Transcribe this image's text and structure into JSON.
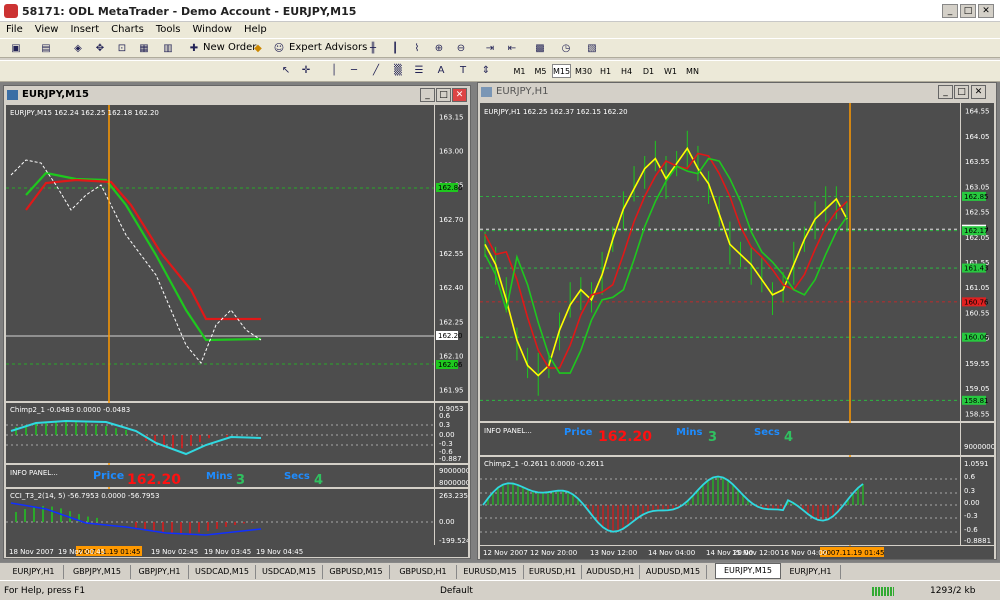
{
  "window": {
    "title": "58171: ODL MetaTrader - Demo Account - EURJPY,M15"
  },
  "menu": [
    "File",
    "View",
    "Insert",
    "Charts",
    "Tools",
    "Window",
    "Help"
  ],
  "toolbar": {
    "new_order": "New Order",
    "expert_advisors": "Expert Advisors"
  },
  "timeframes": [
    "M1",
    "M5",
    "M15",
    "M30",
    "H1",
    "H4",
    "D1",
    "W1",
    "MN"
  ],
  "timeframe_selected": "M15",
  "left_chart": {
    "title": "EURJPY,M15",
    "ohlc": "EURJPY,M15  162.24 162.25 162.18 162.20",
    "price_ticks": [
      "163.15",
      "163.00",
      "162.85",
      "162.70",
      "162.55",
      "162.40",
      "162.25",
      "162.10",
      "161.95"
    ],
    "price_ylim": [
      161.9,
      163.2
    ],
    "current_price": "162.20",
    "green_level": "162.86",
    "green_level2": "162.06",
    "chimp": {
      "label": "Chimp2_1 -0.0483 0.0000 -0.0483",
      "ticks": [
        "0.9053",
        "0.6",
        "0.3",
        "0.00",
        "-0.3",
        "-0.6",
        "-0.887"
      ]
    },
    "info": {
      "label": "INFO PANEL...",
      "price_label": "Price",
      "price_value": "162.20",
      "mins_label": "Mins",
      "mins_value": "3",
      "secs_label": "Secs",
      "secs_value": "4",
      "axis": [
        "9000000",
        "8000000"
      ]
    },
    "cci": {
      "label": "CCI_T3_2(14, 5) -56.7953 0.0000 -56.7953",
      "ticks": [
        "263.2353",
        "0.00",
        "-199.524"
      ]
    },
    "time_labels": [
      "18 Nov 2007",
      "19 Nov 00:45",
      "19 Nov 01:45",
      "19 Nov 02:45",
      "19 Nov 03:45",
      "19 Nov 04:45"
    ],
    "cursor_time": "2007.11.19 01:45"
  },
  "right_chart": {
    "title": "EURJPY,H1",
    "ohlc": "EURJPY,H1  162.25 162.37 162.15 162.20",
    "price_ticks": [
      "164.55",
      "164.05",
      "163.55",
      "163.05",
      "162.55",
      "162.05",
      "161.55",
      "161.05",
      "160.55",
      "160.05",
      "159.55",
      "159.05",
      "158.55"
    ],
    "price_ylim": [
      158.4,
      164.7
    ],
    "tags": [
      {
        "text": "162.85",
        "price": 162.85,
        "color": "#27c93f"
      },
      {
        "text": "162.20",
        "price": 162.2,
        "color": "#ffffff"
      },
      {
        "text": "162.17",
        "price": 162.17,
        "color": "#27c93f"
      },
      {
        "text": "161.43",
        "price": 161.43,
        "color": "#27c93f"
      },
      {
        "text": "160.76",
        "price": 160.76,
        "color": "#e02020"
      },
      {
        "text": "160.06",
        "price": 160.06,
        "color": "#27c93f"
      },
      {
        "text": "158.81",
        "price": 158.81,
        "color": "#27c93f"
      }
    ],
    "info": {
      "label": "INFO PANEL...",
      "price_label": "Price",
      "price_value": "162.20",
      "mins_label": "Mins",
      "mins_value": "3",
      "secs_label": "Secs",
      "secs_value": "4",
      "axis": [
        "9000000"
      ]
    },
    "chimp": {
      "label": "Chimp2_1 -0.2611 0.0000 -0.2611",
      "ticks": [
        "1.0591",
        "0.6",
        "0.3",
        "0.00",
        "-0.3",
        "-0.6",
        "-0.8881"
      ]
    },
    "time_labels": [
      "12 Nov 2007",
      "12 Nov 20:00",
      "13 Nov 12:00",
      "14 Nov 04:00",
      "14 Nov 20:00",
      "15 Nov 12:00",
      "16 Nov 04:00",
      "16 Nov 20:00"
    ],
    "cursor_time": "2007.11.19 01:45"
  },
  "tabs": [
    "EURJPY,H1",
    "GBPJPY,M15",
    "GBPJPY,H1",
    "USDCAD,M15",
    "USDCAD,M15",
    "GBPUSD,M15",
    "GBPUSD,H1",
    "EURUSD,M15",
    "EURUSD,H1",
    "AUDUSD,H1",
    "AUDUSD,M15",
    "EURJPY,M15",
    "EURJPY,H1"
  ],
  "active_tab": 11,
  "status": {
    "help": "For Help, press F1",
    "profile": "Default",
    "traffic": "1293/2 kb"
  },
  "colors": {
    "bg": "#4d4d4d",
    "green": "#1ec81e",
    "red": "#e01818",
    "yellow": "#ffff00",
    "cyan": "#30d8e0",
    "orange": "#ff9900",
    "blue": "#1060ff",
    "grid": "#2dbf2d"
  }
}
